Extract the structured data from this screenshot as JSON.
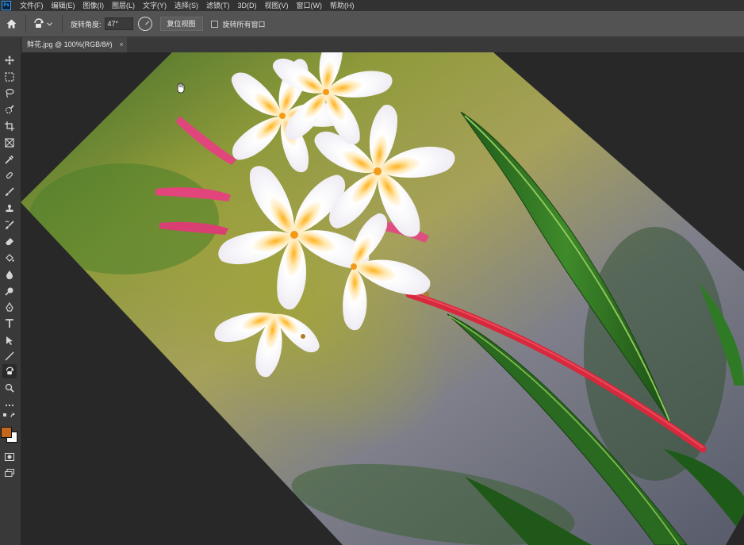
{
  "menu": {
    "logo": "Ps",
    "items": [
      "文件(F)",
      "编辑(E)",
      "图像(I)",
      "图层(L)",
      "文字(Y)",
      "选择(S)",
      "滤镜(T)",
      "3D(D)",
      "视图(V)",
      "窗口(W)",
      "帮助(H)"
    ]
  },
  "options": {
    "rotate_angle_label": "旋转角度:",
    "rotate_angle_value": "47°",
    "reset_view_label": "复位视图",
    "rotate_all_windows_label": "旋转所有窗口",
    "rotate_all_windows_checked": false
  },
  "document": {
    "tab_title": "鲜花.jpg @ 100%(RGB/8#)",
    "close_glyph": "×",
    "rotation_degrees": 47
  },
  "toolbar": {
    "tools": [
      "move-icon",
      "marquee-icon",
      "lasso-icon",
      "quick-select-icon",
      "crop-icon",
      "frame-icon",
      "eyedropper-icon",
      "healing-brush-icon",
      "brush-icon",
      "clone-stamp-icon",
      "history-brush-icon",
      "eraser-icon",
      "paint-bucket-icon",
      "blur-icon",
      "dodge-icon",
      "pen-icon",
      "type-icon",
      "path-select-icon",
      "line-icon",
      "rotate-view-icon",
      "zoom-icon",
      "more-icon"
    ],
    "active_tool": "rotate-view-icon",
    "foreground_color": "#c4671b",
    "background_color": "#ffffff"
  },
  "colors": {
    "menubar_bg": "#323232",
    "options_bg": "#535353",
    "panel_bg": "#393939",
    "workspace_bg": "#282828"
  }
}
